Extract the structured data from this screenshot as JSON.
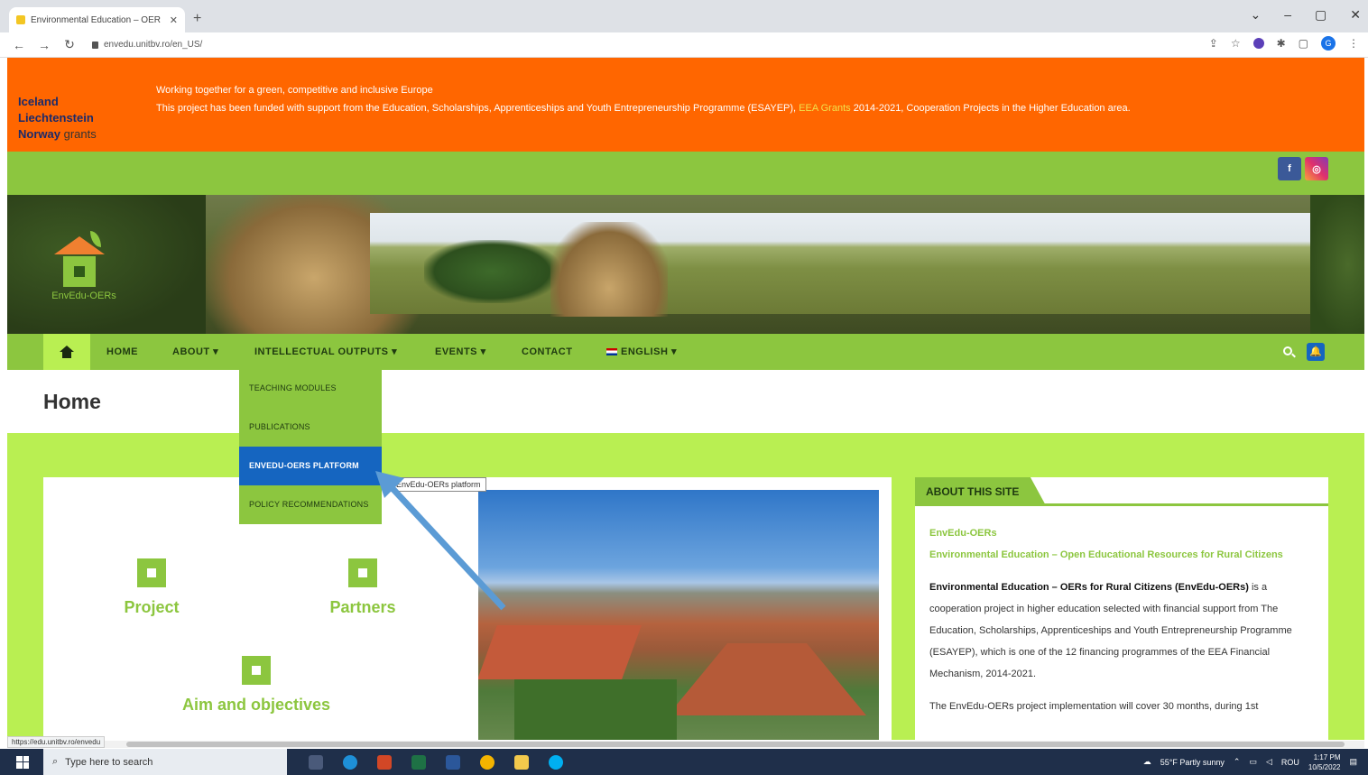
{
  "browser": {
    "tab_title": "Environmental Education – OER",
    "tab_close": "✕",
    "new_tab": "+",
    "url": "envedu.unitbv.ro/en_US/",
    "controls": [
      "⌄",
      "–",
      "▢",
      "✕"
    ]
  },
  "eea": {
    "logo_line1": "Iceland",
    "logo_line2": "Liechtenstein",
    "logo_line3": "Norway",
    "logo_grants": "grants",
    "tagline": "Working together for a green, competitive and inclusive Europe",
    "funding_before": "This project has been funded with support from the Education, Scholarships, Apprenticeships and Youth Entrepreneurship Programme (ESAYEP),",
    "funding_link": "EEA Grants",
    "funding_after": "2014-2021, Cooperation Projects in the Higher Education area."
  },
  "social": {
    "facebook": "f",
    "instagram": "◎"
  },
  "site_logo_text": "EnvEdu-OERs",
  "menu": {
    "home": "HOME",
    "about": "ABOUT ▾",
    "intellectual_outputs": "INTELLECTUAL OUTPUTS ▾",
    "events": "EVENTS ▾",
    "contact": "CONTACT",
    "language": "ENGLISH ▾"
  },
  "dropdown": {
    "items": [
      "TEACHING MODULES",
      "PUBLICATIONS",
      "ENVEDU-OERS PLATFORM",
      "POLICY RECOMMENDATIONS"
    ],
    "tooltip": "EnvEdu-OERs platform"
  },
  "page_title": "Home",
  "features": {
    "project": "Project",
    "partners": "Partners",
    "aim": "Aim and objectives"
  },
  "sidebar": {
    "heading": "ABOUT THIS SITE",
    "name": "EnvEdu-OERs",
    "subtitle": "Environmental Education – Open Educational Resources for Rural Citizens",
    "strong": "Environmental Education – OERs for Rural Citizens (EnvEdu-OERs)",
    "paragraph1": "is a cooperation project in higher education selected with financial support from The Education, Scholarships, Apprenticeships and Youth Entrepreneurship Programme (ESAYEP), which is one of the 12 financing programmes of the EEA Financial Mechanism, 2014-2021.",
    "paragraph2": "The EnvEdu-OERs project implementation will cover 30 months, during 1st"
  },
  "status_url": "https://edu.unitbv.ro/envedu",
  "taskbar": {
    "search_placeholder": "Type here to search",
    "weather": "55°F  Partly sunny",
    "lang": "ROU",
    "time": "1:17 PM",
    "date": "10/5/2022"
  }
}
